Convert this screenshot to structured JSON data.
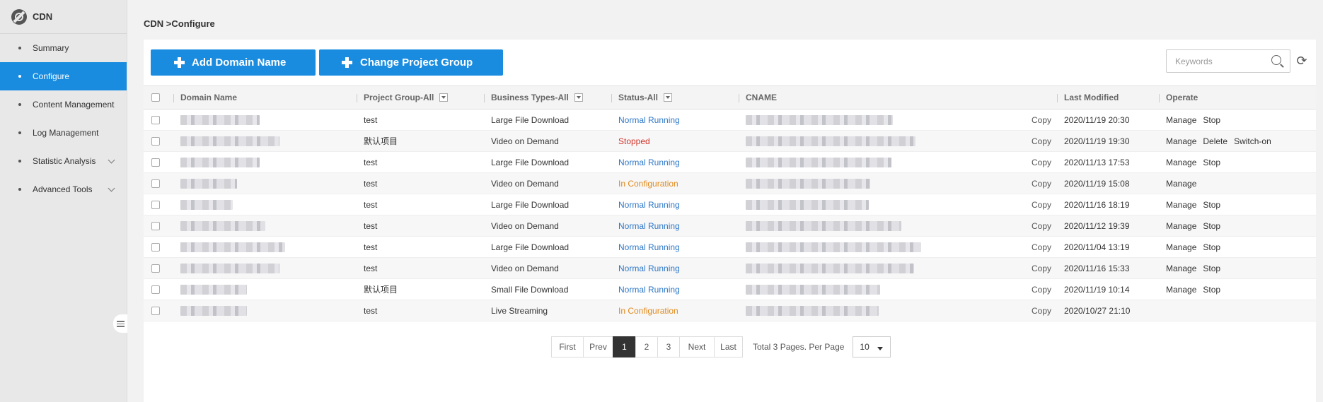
{
  "sidebar": {
    "title": "CDN",
    "items": [
      {
        "label": "Summary"
      },
      {
        "label": "Configure"
      },
      {
        "label": "Content Management"
      },
      {
        "label": "Log Management"
      },
      {
        "label": "Statistic Analysis"
      },
      {
        "label": "Advanced Tools"
      }
    ],
    "active_index": 1
  },
  "breadcrumb": "CDN >Configure",
  "toolbar": {
    "add_label": "Add Domain Name",
    "change_label": "Change Project Group",
    "search_placeholder": "Keywords"
  },
  "table": {
    "headers": {
      "domain": "Domain Name",
      "group": "Project Group-All",
      "btype": "Business Types-All",
      "status": "Status-All",
      "cname": "CNAME",
      "modified": "Last Modified",
      "operate": "Operate"
    },
    "rows": [
      {
        "group": "test",
        "btype": "Large File Download",
        "status": "Normal Running",
        "copy": "Copy",
        "modified": "2020/11/19 20:30",
        "ops": [
          "Manage",
          "Stop"
        ]
      },
      {
        "group": "默认项目",
        "btype": "Video on Demand",
        "status": "Stopped",
        "copy": "Copy",
        "modified": "2020/11/19 19:30",
        "ops": [
          "Manage",
          "Delete",
          "Switch-on"
        ]
      },
      {
        "group": "test",
        "btype": "Large File Download",
        "status": "Normal Running",
        "copy": "Copy",
        "modified": "2020/11/13 17:53",
        "ops": [
          "Manage",
          "Stop"
        ]
      },
      {
        "group": "test",
        "btype": "Video on Demand",
        "status": "In Configuration",
        "copy": "Copy",
        "modified": "2020/11/19 15:08",
        "ops": [
          "Manage"
        ]
      },
      {
        "group": "test",
        "btype": "Large File Download",
        "status": "Normal Running",
        "copy": "Copy",
        "modified": "2020/11/16 18:19",
        "ops": [
          "Manage",
          "Stop"
        ]
      },
      {
        "group": "test",
        "btype": "Video on Demand",
        "status": "Normal Running",
        "copy": "Copy",
        "modified": "2020/11/12 19:39",
        "ops": [
          "Manage",
          "Stop"
        ]
      },
      {
        "group": "test",
        "btype": "Large File Download",
        "status": "Normal Running",
        "copy": "Copy",
        "modified": "2020/11/04 13:19",
        "ops": [
          "Manage",
          "Stop"
        ]
      },
      {
        "group": "test",
        "btype": "Video on Demand",
        "status": "Normal Running",
        "copy": "Copy",
        "modified": "2020/11/16 15:33",
        "ops": [
          "Manage",
          "Stop"
        ]
      },
      {
        "group": "默认项目",
        "btype": "Small File Download",
        "status": "Normal Running",
        "copy": "Copy",
        "modified": "2020/11/19 10:14",
        "ops": [
          "Manage",
          "Stop"
        ]
      },
      {
        "group": "test",
        "btype": "Live Streaming",
        "status": "In Configuration",
        "copy": "Copy",
        "modified": "2020/10/27 21:10",
        "ops": []
      }
    ]
  },
  "pagination": {
    "first": "First",
    "prev": "Prev",
    "pages": [
      "1",
      "2",
      "3"
    ],
    "current": "1",
    "next": "Next",
    "last": "Last",
    "info": "Total 3 Pages. Per Page",
    "page_size": "10"
  },
  "colors": {
    "accent": "#1a8ce0",
    "running": "#2d77c7",
    "stopped": "#d0342c",
    "configuring": "#e08a1e"
  }
}
